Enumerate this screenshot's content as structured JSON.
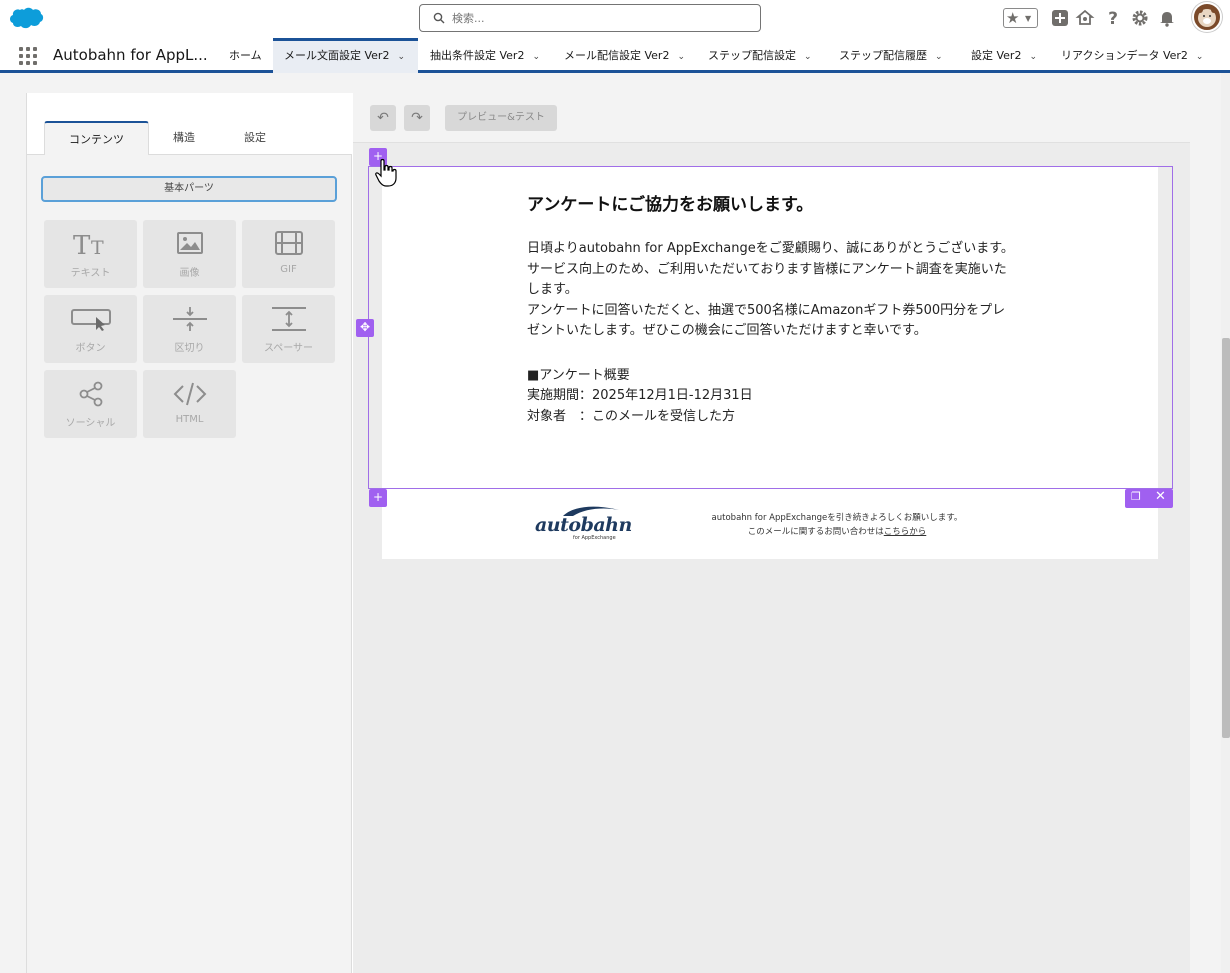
{
  "header": {
    "search_placeholder": "検索...",
    "icons": [
      "favorites-star-icon",
      "add-icon",
      "trailhead-icon",
      "help-icon",
      "gear-icon",
      "bell-icon",
      "avatar"
    ]
  },
  "nav": {
    "app_name": "Autobahn for AppL...",
    "tabs": [
      {
        "label": "ホーム",
        "active": false,
        "chevron": false
      },
      {
        "label": "メール文面設定 Ver2",
        "active": true,
        "chevron": true
      },
      {
        "label": "抽出条件設定 Ver2",
        "active": false,
        "chevron": true
      },
      {
        "label": "メール配信設定 Ver2",
        "active": false,
        "chevron": true
      },
      {
        "label": "ステップ配信設定",
        "active": false,
        "chevron": true
      },
      {
        "label": "ステップ配信履歴",
        "active": false,
        "chevron": true
      },
      {
        "label": "設定 Ver2",
        "active": false,
        "chevron": true
      },
      {
        "label": "リアクションデータ Ver2",
        "active": false,
        "chevron": true
      }
    ]
  },
  "left_panel": {
    "tabs": [
      "コンテンツ",
      "構造",
      "設定"
    ],
    "section_button": "基本パーツ",
    "tiles": [
      {
        "label": "テキスト",
        "icon": "text-icon"
      },
      {
        "label": "画像",
        "icon": "image-icon"
      },
      {
        "label": "GIF",
        "icon": "gif-icon"
      },
      {
        "label": "ボタン",
        "icon": "button-icon"
      },
      {
        "label": "区切り",
        "icon": "divider-icon"
      },
      {
        "label": "スペーサー",
        "icon": "spacer-icon"
      },
      {
        "label": "ソーシャル",
        "icon": "share-icon"
      },
      {
        "label": "HTML",
        "icon": "code-icon"
      }
    ]
  },
  "editor": {
    "undo": "↶",
    "redo": "↷",
    "preview_button": "プレビュー&テスト",
    "email": {
      "heading": "アンケートにご協力をお願いします。",
      "para1": "日頃よりautobahn for AppExchangeをご愛顧賜り、誠にありがとうございます。",
      "para2": "サービス向上のため、ご利用いただいております皆様にアンケート調査を実施いたします。",
      "para3": "アンケートに回答いただくと、抽選で500名様にAmazonギフト券500円分をプレゼントいたします。ぜひこの機会にご回答いただけますと幸いです。",
      "overview_title": "■アンケート概要",
      "period": "実施期間：2025年12月1日-12月31日",
      "target": "対象者　：このメールを受信した方"
    },
    "footer": {
      "brand": "autobahn",
      "brand_sub": "for AppExchange",
      "line1": "autobahn for AppExchangeを引き続きよろしくお願いします。",
      "line2_prefix": "このメールに関するお問い合わせは",
      "line2_link": "こちらから"
    }
  },
  "colors": {
    "brand_blue": "#1b5297",
    "selection_purple": "#a060f0",
    "salesforce_cloud": "#0d9dda"
  }
}
